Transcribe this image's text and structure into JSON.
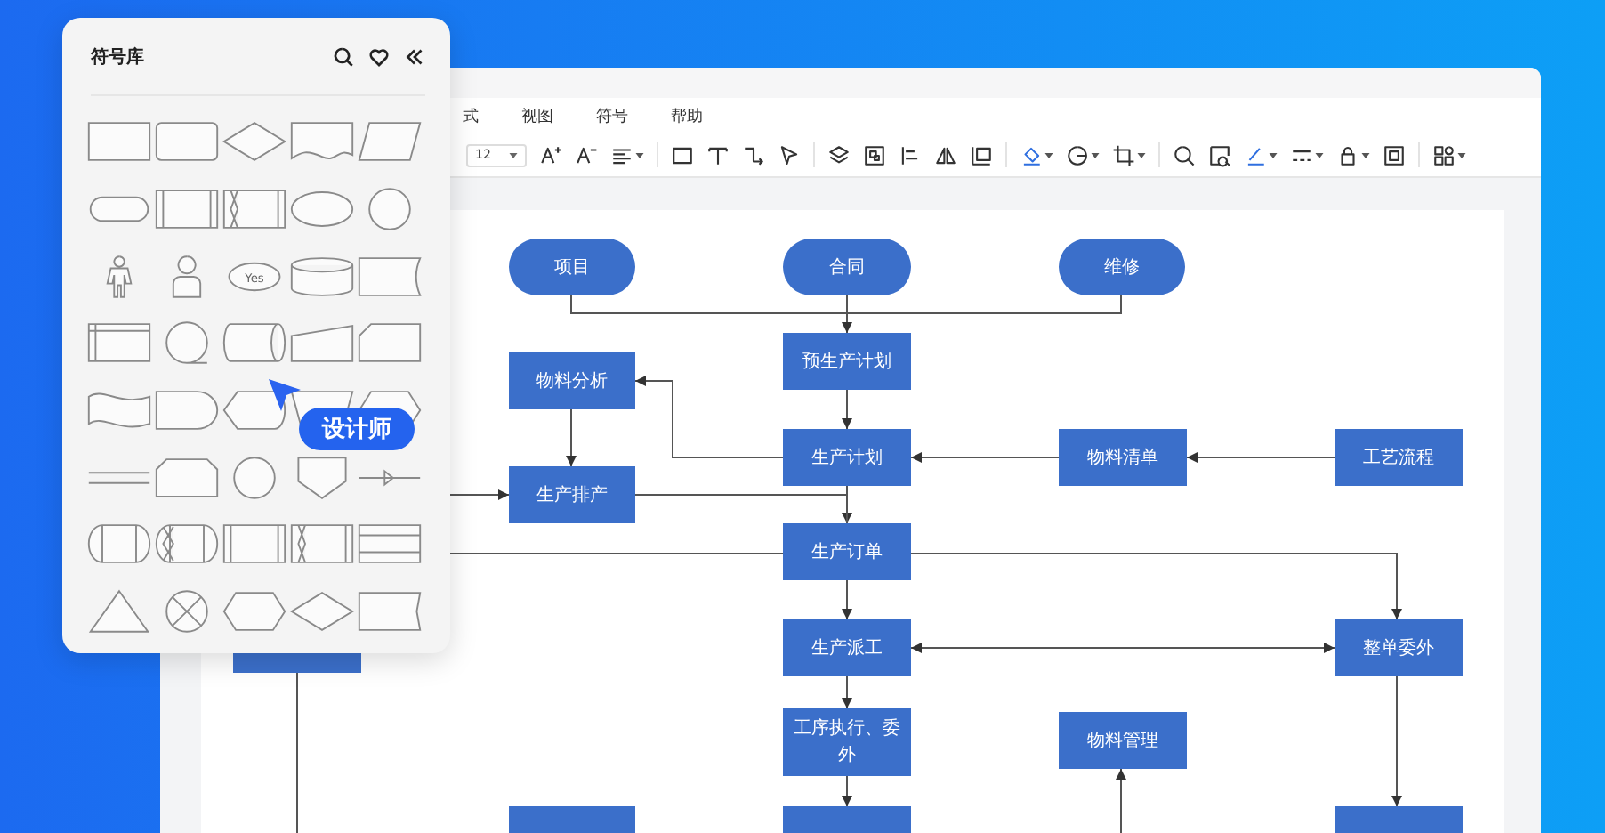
{
  "menu": [
    {
      "label": "式"
    },
    {
      "label": "视图"
    },
    {
      "label": "符号"
    },
    {
      "label": "帮助"
    }
  ],
  "toolbar": {
    "font_size": "12"
  },
  "symbol_panel": {
    "title": "符号库",
    "symbols": [
      {
        "kind": "rect"
      },
      {
        "kind": "rounded-rect"
      },
      {
        "kind": "diamond"
      },
      {
        "kind": "document"
      },
      {
        "kind": "parallelogram"
      },
      {
        "kind": "terminator"
      },
      {
        "kind": "predefined"
      },
      {
        "kind": "predefined-x"
      },
      {
        "kind": "ellipse"
      },
      {
        "kind": "circle"
      },
      {
        "kind": "person"
      },
      {
        "kind": "user"
      },
      {
        "kind": "ellipse-label",
        "label": "Yes"
      },
      {
        "kind": "cylinder"
      },
      {
        "kind": "stored-data"
      },
      {
        "kind": "internal-storage"
      },
      {
        "kind": "circle-tail"
      },
      {
        "kind": "drum"
      },
      {
        "kind": "manual-input"
      },
      {
        "kind": "card"
      },
      {
        "kind": "tape"
      },
      {
        "kind": "delay"
      },
      {
        "kind": "display"
      },
      {
        "kind": "trapezoid"
      },
      {
        "kind": "hexagon"
      },
      {
        "kind": "double-line"
      },
      {
        "kind": "loop-limit"
      },
      {
        "kind": "circle"
      },
      {
        "kind": "off-page"
      },
      {
        "kind": "line-arrow"
      },
      {
        "kind": "rounded-ends"
      },
      {
        "kind": "rounded-ends-x"
      },
      {
        "kind": "predefined"
      },
      {
        "kind": "predefined-x"
      },
      {
        "kind": "rect-double-line"
      },
      {
        "kind": "triangle"
      },
      {
        "kind": "circle-x"
      },
      {
        "kind": "hexagon"
      },
      {
        "kind": "diamond"
      },
      {
        "kind": "flag"
      }
    ]
  },
  "cursor_tag": {
    "label": "设计师"
  },
  "flowchart": {
    "nodes": [
      {
        "kind": "terminal",
        "label": "项目"
      },
      {
        "kind": "terminal",
        "label": "合同"
      },
      {
        "kind": "terminal",
        "label": "维修"
      },
      {
        "kind": "process",
        "label": "预生产计划"
      },
      {
        "kind": "process",
        "label": "物料分析"
      },
      {
        "kind": "process",
        "label": "生产计划"
      },
      {
        "kind": "process",
        "label": "物料清单"
      },
      {
        "kind": "process",
        "label": "工艺流程"
      },
      {
        "kind": "process",
        "label": "生产排产"
      },
      {
        "kind": "process",
        "label": "生产订单"
      },
      {
        "kind": "process"
      },
      {
        "kind": "process",
        "label": "生产派工"
      },
      {
        "kind": "process",
        "label": "整单委外"
      },
      {
        "kind": "process",
        "label": "工序执行、委外"
      },
      {
        "kind": "process",
        "label": "物料管理"
      },
      {
        "kind": "process"
      },
      {
        "kind": "process"
      },
      {
        "kind": "process"
      }
    ]
  }
}
